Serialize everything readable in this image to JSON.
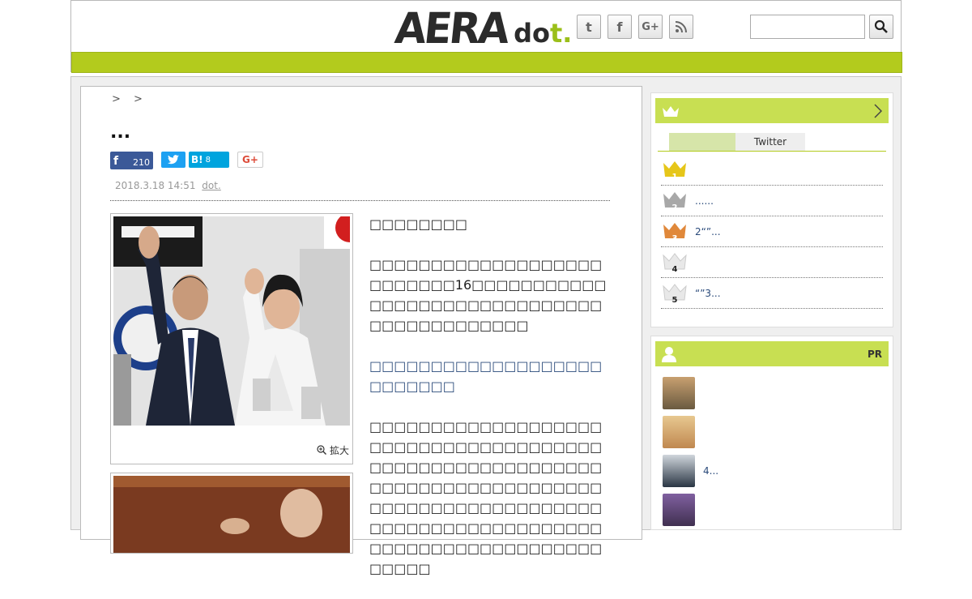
{
  "header": {
    "logo_main": "AERA",
    "logo_sub_1": "do",
    "logo_sub_2": "t.",
    "social": [
      {
        "label": "t",
        "icon": "twitter-icon"
      },
      {
        "label": "f",
        "icon": "facebook-icon"
      },
      {
        "label": "G+",
        "icon": "google-plus-icon"
      },
      {
        "label": "",
        "icon": "rss-icon"
      }
    ],
    "search": {
      "value": "",
      "placeholder": ""
    },
    "accent_color": "#b3cb1d"
  },
  "article": {
    "breadcrumb": "> >",
    "title": "...",
    "share": {
      "facebook_count": "210",
      "twitter_label": "",
      "hatena_label": "B!",
      "hatena_count": "8",
      "gplus_label": "G+"
    },
    "date": "2018.3.18 14:51",
    "source": "dot.",
    "photo_zoom_label": "拡大",
    "paragraphs": [
      "□□□□□□□□",
      "□□□□□□□□□□□□□□□□□□□□□□□□□□16□□□□□□□□□□□□□□□□□□□□□□□□□□□□□□□□□□□□□□□□□□□",
      "□□□□□□□□□□□□□□□□□□□□□□□□□□",
      "□□□□□□□□□□□□□□□□□□□□□□□□□□□□□□□□□□□□□□□□□□□□□□□□□□□□□□□□□□□□□□□□□□□□□□□□□□□□□□□□□□□□□□□□□□□□□□□□□□□□□□□□□□□□□□□□□□□□□□□□□□□□□□□□□□□□□□□□□□"
    ]
  },
  "sidebar": {
    "ranking": {
      "title": "",
      "tabs": [
        "",
        "Twitter"
      ],
      "items": [
        {
          "rank": "1",
          "text": "",
          "color": "#e6c619"
        },
        {
          "rank": "2",
          "text": "......",
          "color": "#a8a8a8"
        },
        {
          "rank": "3",
          "text": "2“”...",
          "color": "#e0883a"
        },
        {
          "rank": "4",
          "text": "",
          "color": "#d0d0d0"
        },
        {
          "rank": "5",
          "text": "“”3...",
          "color": "#d0d0d0"
        }
      ]
    },
    "pr": {
      "title": "PR",
      "items": [
        {
          "text": "",
          "avatar_color": "#8a7a60"
        },
        {
          "text": "",
          "avatar_color": "#d9a86a"
        },
        {
          "text": "4...",
          "avatar_color": "#3a4a5a"
        },
        {
          "text": "",
          "avatar_color": "#6a5080"
        }
      ]
    }
  }
}
